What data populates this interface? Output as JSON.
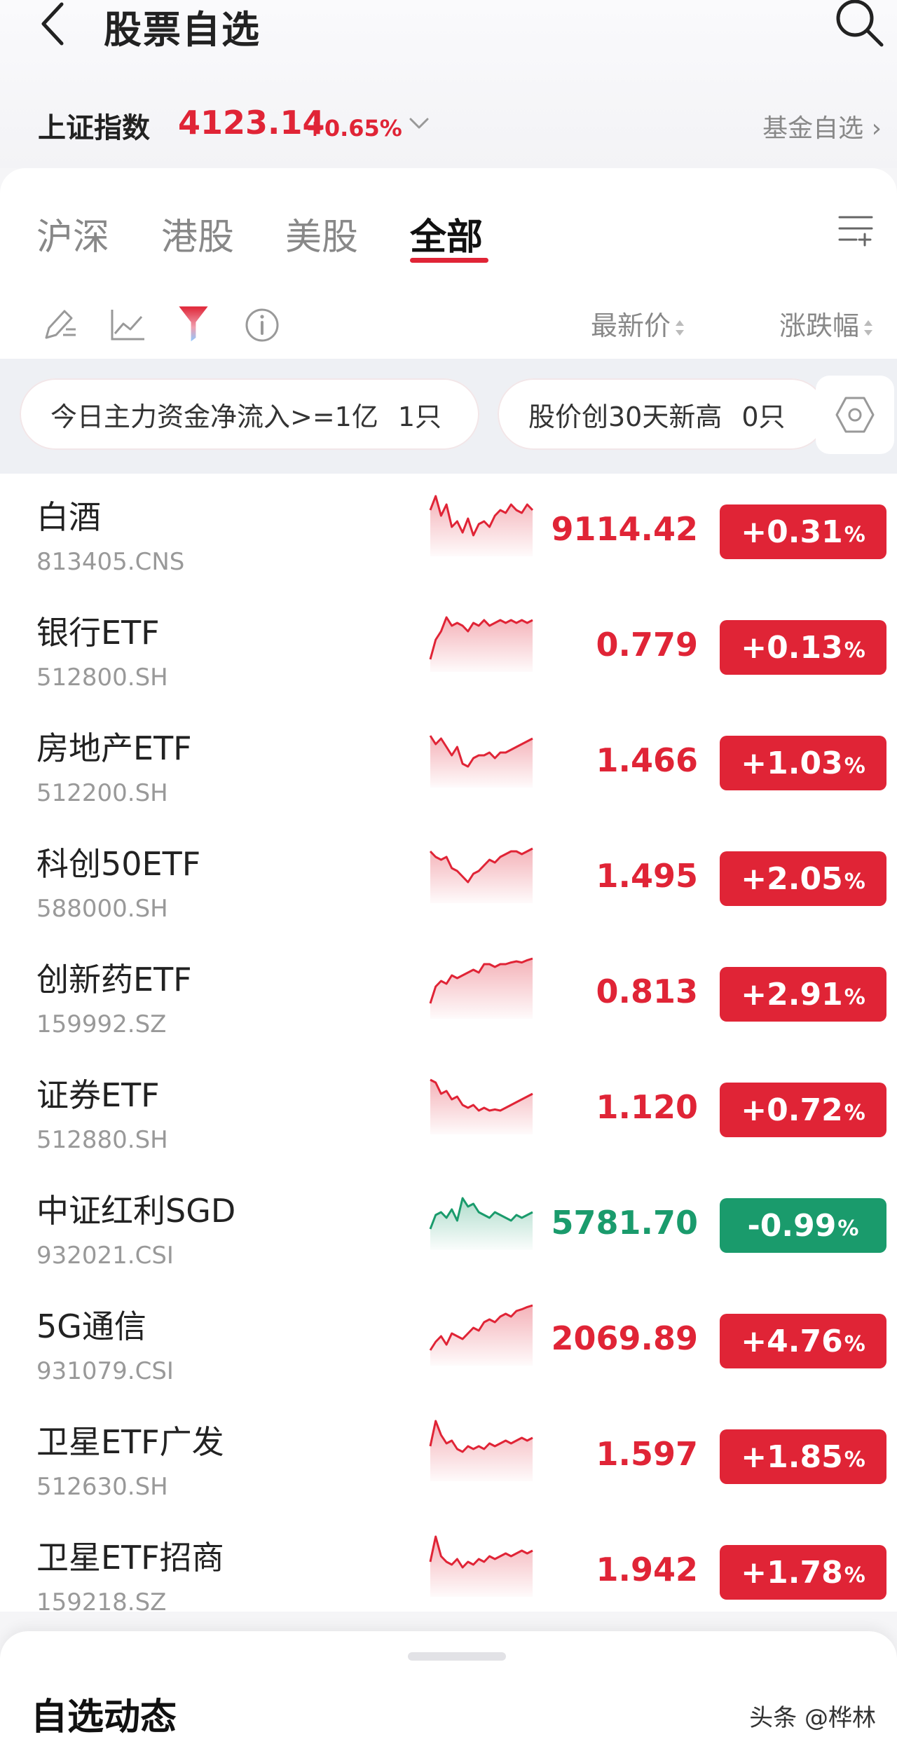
{
  "header": {
    "title": "股票自选",
    "back_icon": "chevron-left-icon",
    "search_icon": "search-icon"
  },
  "index_bar": {
    "name": "上证指数",
    "value": "4123.14",
    "change": "+0.65%",
    "fund_link": "基金自选",
    "color": "#e02436"
  },
  "tabs": [
    {
      "label": "沪深",
      "active": false
    },
    {
      "label": "港股",
      "active": false
    },
    {
      "label": "美股",
      "active": false
    },
    {
      "label": "全部",
      "active": true
    }
  ],
  "columns": {
    "price": "最新价",
    "change": "涨跌幅"
  },
  "filters": [
    {
      "label": "今日主力资金净流入>=1亿",
      "count": "1只"
    },
    {
      "label": "股价创30天新高",
      "count": "0只"
    }
  ],
  "colors": {
    "up": "#e02436",
    "down": "#1a9b6c"
  },
  "stocks": [
    {
      "name": "白酒",
      "code": "813405.CNS",
      "price": "9114.42",
      "change": "+0.31",
      "pct": "%",
      "dir": "up"
    },
    {
      "name": "银行ETF",
      "code": "512800.SH",
      "price": "0.779",
      "change": "+0.13",
      "pct": "%",
      "dir": "up"
    },
    {
      "name": "房地产ETF",
      "code": "512200.SH",
      "price": "1.466",
      "change": "+1.03",
      "pct": "%",
      "dir": "up"
    },
    {
      "name": "科创50ETF",
      "code": "588000.SH",
      "price": "1.495",
      "change": "+2.05",
      "pct": "%",
      "dir": "up"
    },
    {
      "name": "创新药ETF",
      "code": "159992.SZ",
      "price": "0.813",
      "change": "+2.91",
      "pct": "%",
      "dir": "up"
    },
    {
      "name": "证券ETF",
      "code": "512880.SH",
      "price": "1.120",
      "change": "+0.72",
      "pct": "%",
      "dir": "up"
    },
    {
      "name": "中证红利SGD",
      "code": "932021.CSI",
      "price": "5781.70",
      "change": "-0.99",
      "pct": "%",
      "dir": "down"
    },
    {
      "name": "5G通信",
      "code": "931079.CSI",
      "price": "2069.89",
      "change": "+4.76",
      "pct": "%",
      "dir": "up"
    },
    {
      "name": "卫星ETF广发",
      "code": "512630.SH",
      "price": "1.597",
      "change": "+1.85",
      "pct": "%",
      "dir": "up"
    },
    {
      "name": "卫星ETF招商",
      "code": "159218.SZ",
      "price": "1.942",
      "change": "+1.78",
      "pct": "%",
      "dir": "up"
    }
  ],
  "sheet": {
    "title": "自选动态"
  },
  "watermark": "头条 @桦林"
}
